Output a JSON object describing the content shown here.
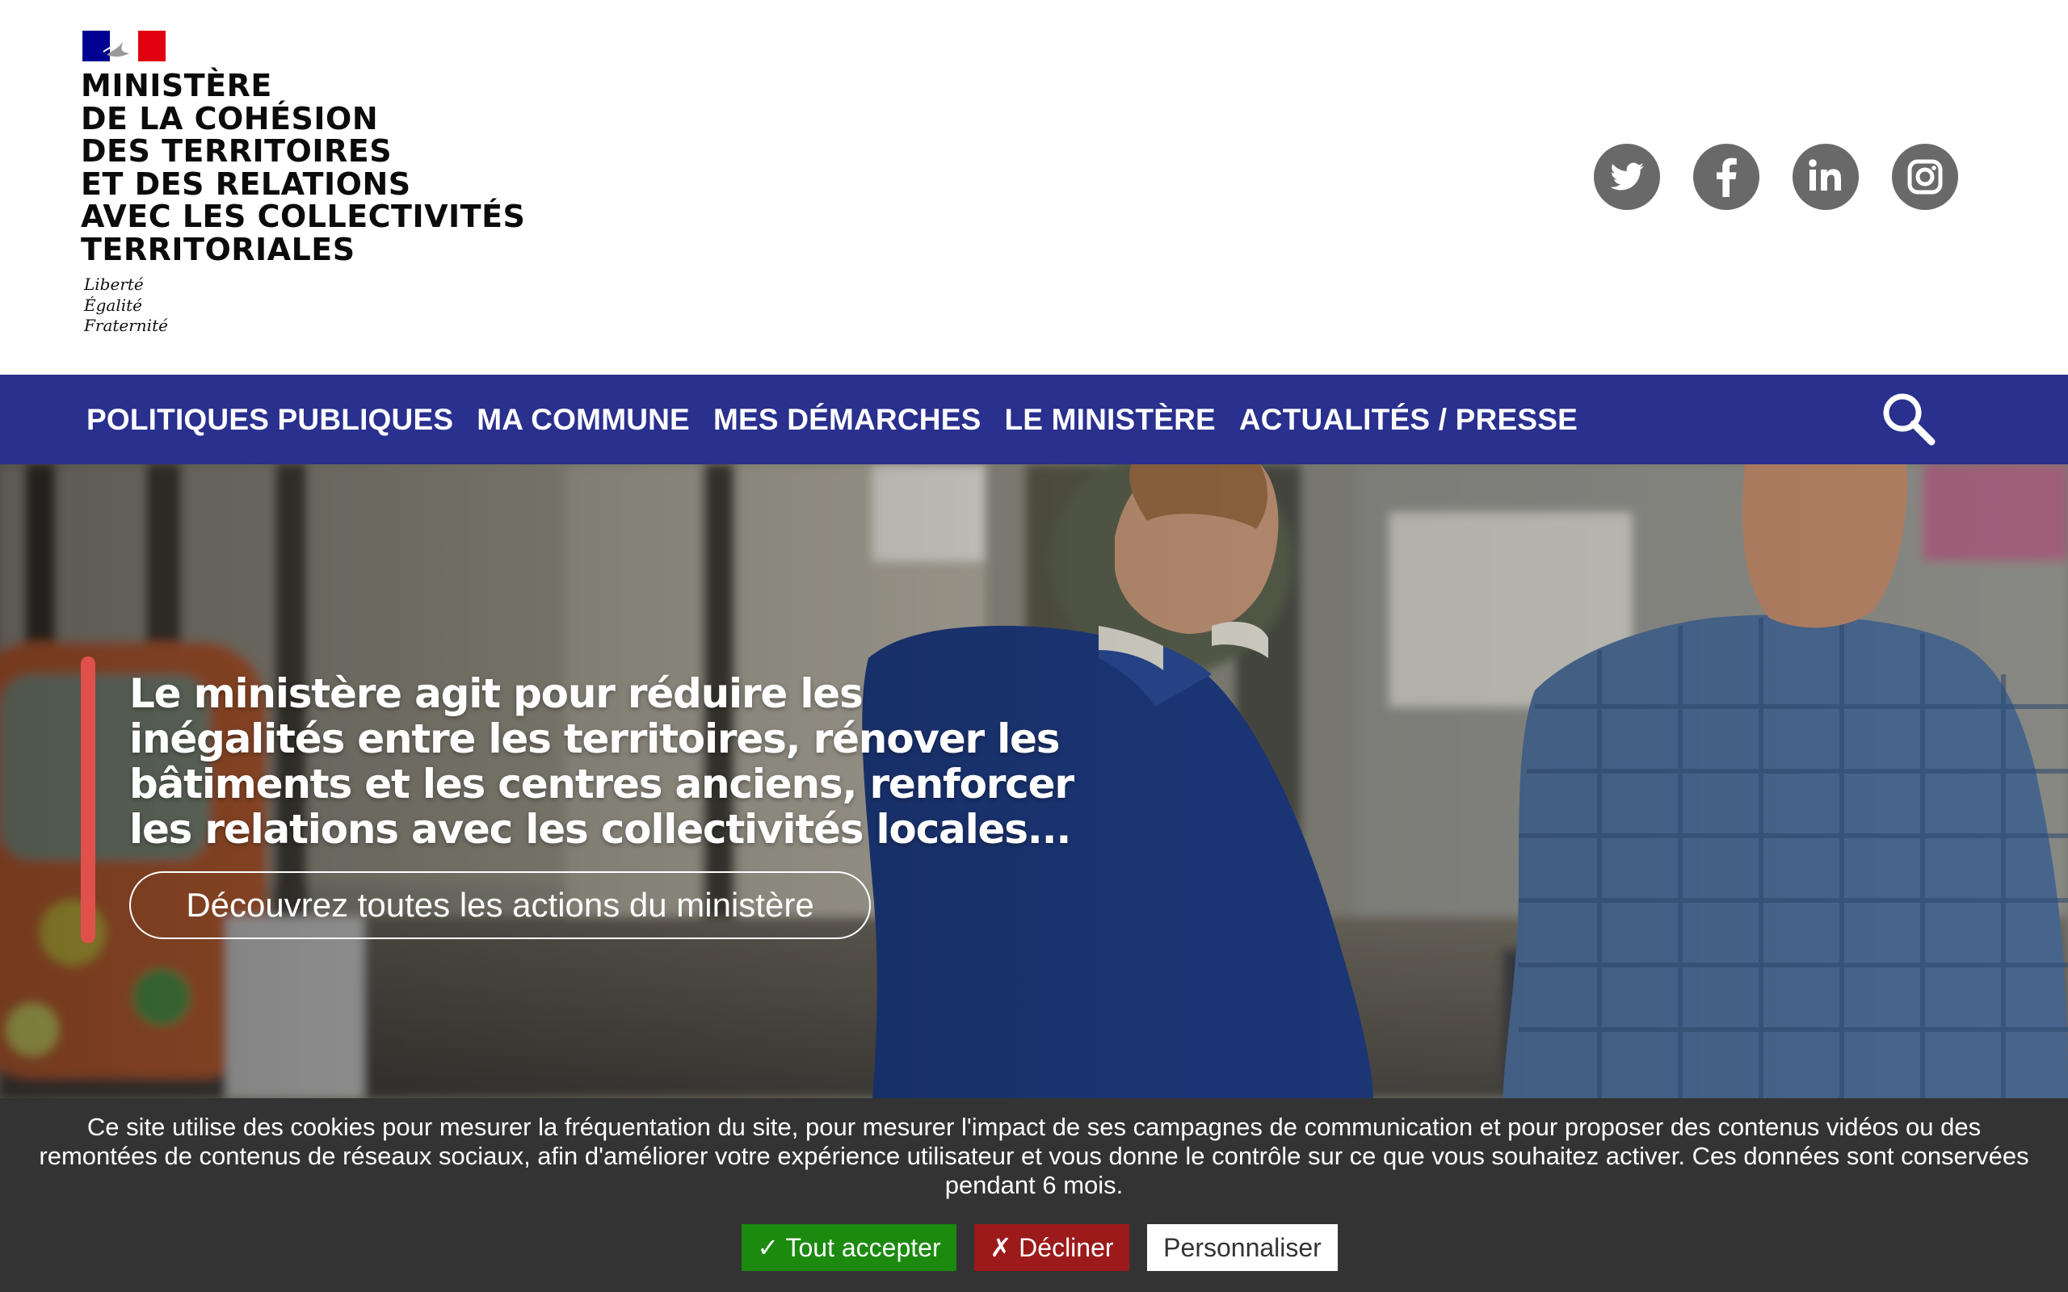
{
  "header": {
    "ministry_name_lines": [
      "MINISTÈRE",
      "DE LA COHÉSION",
      "DES TERRITOIRES",
      "ET DES RELATIONS",
      "AVEC LES COLLECTIVITÉS",
      "TERRITORIALES"
    ],
    "devise_lines": [
      "Liberté",
      "Égalité",
      "Fraternité"
    ],
    "flag_colors": {
      "blue": "#000091",
      "white": "#ffffff",
      "red": "#e1000f"
    },
    "social_links": [
      {
        "icon": "twitter-icon"
      },
      {
        "icon": "facebook-icon"
      },
      {
        "icon": "linkedin-icon"
      },
      {
        "icon": "instagram-icon"
      }
    ]
  },
  "nav": {
    "items": [
      {
        "label": "POLITIQUES PUBLIQUES"
      },
      {
        "label": "MA COMMUNE"
      },
      {
        "label": "MES DÉMARCHES"
      },
      {
        "label": "LE MINISTÈRE"
      },
      {
        "label": "ACTUALITÉS / PRESSE"
      }
    ],
    "search_icon": "search-icon",
    "background": "#29308e"
  },
  "hero": {
    "headline": "Le ministère agit pour réduire les inégalités entre les territoires, rénover les bâtiments et les centres anciens, renforcer les relations avec les collectivités locales...",
    "cta_label": "Découvrez toutes les actions du ministère",
    "accent_color": "#e1514c"
  },
  "cookie_banner": {
    "text": "Ce site utilise des cookies pour mesurer la fréquentation du site, pour mesurer l'impact de ses campagnes de communication et pour proposer des contenus vidéos ou des remontées de contenus de réseaux sociaux, afin d'améliorer votre expérience utilisateur et vous donne le contrôle sur ce que vous souhaitez activer. Ces données sont conservées pendant 6 mois.",
    "accept_label": "✓ Tout accepter",
    "decline_label": "✗ Décliner",
    "customize_label": "Personnaliser",
    "accept_color": "#1b8a0f",
    "decline_color": "#9c1a1a",
    "background": "#333333"
  }
}
